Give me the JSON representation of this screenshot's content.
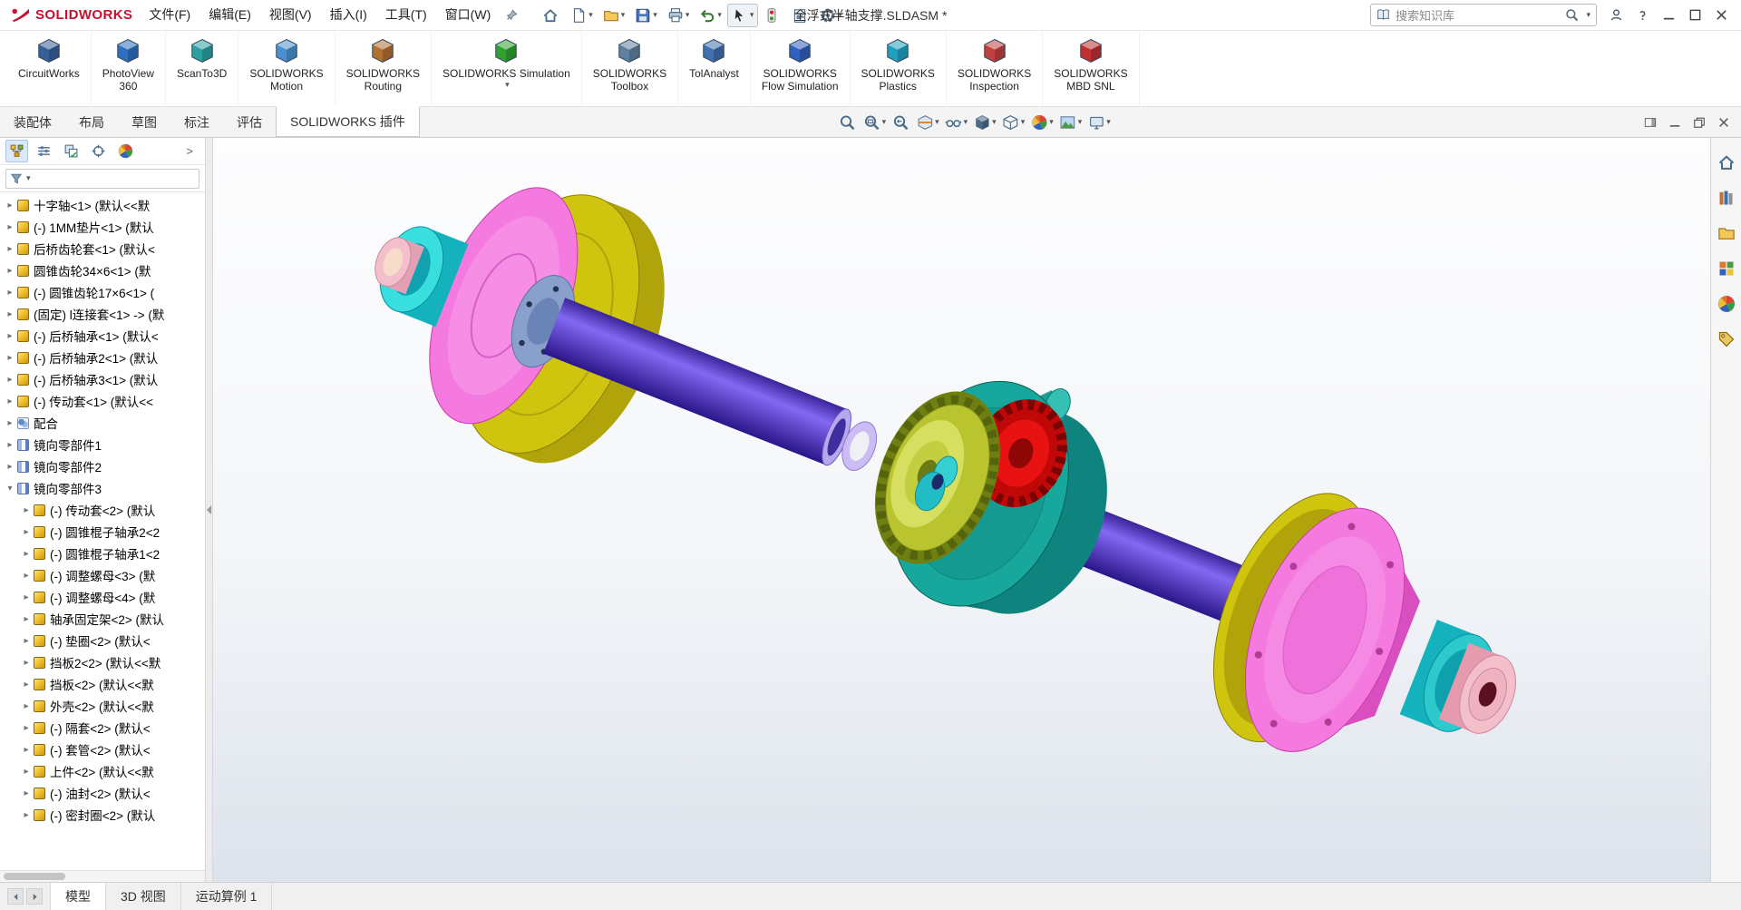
{
  "titlebar": {
    "brand": "SOLIDWORKS",
    "menus": [
      {
        "label": "文件(F)"
      },
      {
        "label": "编辑(E)"
      },
      {
        "label": "视图(V)"
      },
      {
        "label": "插入(I)"
      },
      {
        "label": "工具(T)"
      },
      {
        "label": "窗口(W)"
      }
    ],
    "document_title": "全浮式半轴支撑.SLDASM *",
    "quick_toolbar": [
      {
        "name": "home-button",
        "sym": "#i-home"
      },
      {
        "name": "new-document-button",
        "sym": "#i-newdoc",
        "caret": "▾"
      },
      {
        "name": "open-button",
        "sym": "#i-folder",
        "caret": "▾"
      },
      {
        "name": "save-button",
        "sym": "#i-floppy",
        "caret": "▾"
      },
      {
        "name": "print-button",
        "sym": "#i-printer",
        "caret": "▾"
      },
      {
        "name": "undo-button",
        "sym": "#i-undo",
        "caret": "▾"
      },
      {
        "name": "select-button",
        "sym": "#i-cursor",
        "caret": "▾",
        "boxed": "1"
      },
      {
        "name": "rebuild-button",
        "sym": "#i-rebuild"
      },
      {
        "name": "task-list-button",
        "sym": "#i-clipboard"
      },
      {
        "name": "options-button",
        "sym": "#i-gear",
        "caret": "▾"
      }
    ],
    "search": {
      "placeholder": "搜索知识库",
      "caret": "▾"
    },
    "right_icons": [
      {
        "name": "user-account-button",
        "sym": "#i-person"
      },
      {
        "name": "help-button",
        "sym": "#i-question"
      },
      {
        "name": "minimize-button",
        "sym": "#i-min"
      },
      {
        "name": "maximize-button",
        "sym": "#i-max"
      },
      {
        "name": "close-button",
        "sym": "#i-close"
      }
    ]
  },
  "ribbon": {
    "addins": [
      {
        "id": "circuitworks-button",
        "l1": "CircuitWorks",
        "l2": "",
        "style": "color:#35609a"
      },
      {
        "id": "photoview-360-button",
        "l1": "PhotoView",
        "l2": "360",
        "style": "color:#2e6fc0"
      },
      {
        "id": "scanto3d-button",
        "l1": "ScanTo3D",
        "l2": "",
        "style": "color:#2aa0a0"
      },
      {
        "id": "solidworks-motion-button",
        "l1": "SOLIDWORKS",
        "l2": "Motion",
        "style": "color:#4a90d0"
      },
      {
        "id": "solidworks-routing-button",
        "l1": "SOLIDWORKS",
        "l2": "Routing",
        "style": "color:#b07030"
      },
      {
        "id": "solidworks-simulation-button",
        "l1": "SOLIDWORKS Simulation",
        "l2": "",
        "style": "color:#30a030",
        "caret": "▾"
      },
      {
        "id": "solidworks-toolbox-button",
        "l1": "SOLIDWORKS",
        "l2": "Toolbox",
        "style": "color:#6080a0"
      },
      {
        "id": "tolanalyst-button",
        "l1": "TolAnalyst",
        "l2": "",
        "style": "color:#4070b0"
      },
      {
        "id": "solidworks-flow-simulation-button",
        "l1": "SOLIDWORKS",
        "l2": "Flow Simulation",
        "style": "color:#3060c0"
      },
      {
        "id": "solidworks-plastics-button",
        "l1": "SOLIDWORKS",
        "l2": "Plastics",
        "style": "color:#20a0c0"
      },
      {
        "id": "solidworks-inspection-button",
        "l1": "SOLIDWORKS",
        "l2": "Inspection",
        "style": "color:#c04040"
      },
      {
        "id": "solidworks-mbd-snl-button",
        "l1": "SOLIDWORKS",
        "l2": "MBD SNL",
        "style": "color:#c03030"
      }
    ]
  },
  "command_tabs": {
    "tabs": [
      {
        "label": "装配体"
      },
      {
        "label": "布局"
      },
      {
        "label": "草图"
      },
      {
        "label": "标注"
      },
      {
        "label": "评估"
      },
      {
        "label": "SOLIDWORKS 插件",
        "active": "1"
      }
    ]
  },
  "headsup": {
    "items": [
      {
        "name": "zoom-fit-icon",
        "sym": "#i-magnifier"
      },
      {
        "name": "zoom-area-icon",
        "sym": "#i-magnifier-rect",
        "caret": "▾"
      },
      {
        "name": "previous-view-icon",
        "sym": "#i-magnifier-prev"
      },
      {
        "name": "section-view-icon",
        "sym": "#i-section",
        "caret": "▾"
      },
      {
        "name": "hide-show-items-icon",
        "sym": "#i-glasses",
        "caret": "▾"
      },
      {
        "name": "view-orientation-icon",
        "sym": "#i-addin",
        "caret": "▾"
      },
      {
        "name": "display-style-icon",
        "sym": "#i-cube-wire",
        "caret": "▾"
      },
      {
        "name": "edit-appearance-icon",
        "sym": "#i-beachball",
        "caret": "▾"
      },
      {
        "name": "apply-scene-icon",
        "sym": "#i-scene",
        "caret": "▾"
      },
      {
        "name": "view-settings-icon",
        "sym": "#i-monitor",
        "caret": "▾"
      }
    ]
  },
  "doc_window_icons": [
    {
      "name": "pane-toggle-button",
      "sym": "#i-pane"
    },
    {
      "name": "doc-minimize-button",
      "sym": "#i-min"
    },
    {
      "name": "doc-restore-button",
      "sym": "#i-restore"
    },
    {
      "name": "doc-close-button",
      "sym": "#i-close"
    }
  ],
  "feature_panel": {
    "tabs": [
      {
        "name": "featuremanager-tab",
        "sym": "#i-tree",
        "active": "1"
      },
      {
        "name": "propertymanager-tab",
        "sym": "#i-sliders"
      },
      {
        "name": "configurationmanager-tab",
        "sym": "#i-config"
      },
      {
        "name": "dimxpertmanager-tab",
        "sym": "#i-target"
      },
      {
        "name": "displaymanager-tab",
        "sym": "#i-beachball"
      }
    ],
    "expand_glyph": ">",
    "filter": {
      "caret": "▾"
    },
    "items": [
      {
        "level": "1",
        "type": "part",
        "icon_name": "part-icon",
        "arrow": "▸",
        "label": "十字轴<1> (默认<<默"
      },
      {
        "level": "1",
        "type": "part",
        "icon_name": "part-icon",
        "arrow": "▸",
        "label": "(-) 1MM垫片<1> (默认"
      },
      {
        "level": "1",
        "type": "part",
        "icon_name": "part-icon",
        "arrow": "▸",
        "label": "后桥齿轮套<1> (默认<"
      },
      {
        "level": "1",
        "type": "part",
        "icon_name": "part-icon",
        "arrow": "▸",
        "label": "圆锥齿轮34×6<1> (默"
      },
      {
        "level": "1",
        "type": "part",
        "icon_name": "part-icon",
        "arrow": "▸",
        "label": "(-) 圆锥齿轮17×6<1> ("
      },
      {
        "level": "1",
        "type": "part",
        "icon_name": "part-icon",
        "arrow": "▸",
        "label": "(固定) l连接套<1> -> (默"
      },
      {
        "level": "1",
        "type": "part",
        "icon_name": "part-icon",
        "arrow": "▸",
        "label": "(-) 后桥轴承<1> (默认<"
      },
      {
        "level": "1",
        "type": "part",
        "icon_name": "part-icon",
        "arrow": "▸",
        "label": "(-) 后桥轴承2<1> (默认"
      },
      {
        "level": "1",
        "type": "part",
        "icon_name": "part-icon",
        "arrow": "▸",
        "label": "(-) 后桥轴承3<1> (默认"
      },
      {
        "level": "1",
        "type": "part",
        "icon_name": "part-icon",
        "arrow": "▸",
        "label": "(-) 传动套<1> (默认<<"
      },
      {
        "level": "1",
        "type": "mates",
        "icon_name": "mates-icon",
        "arrow": "▸",
        "label": "配合"
      },
      {
        "level": "1",
        "type": "mirror",
        "icon_name": "mirror-component-icon",
        "arrow": "▸",
        "label": "镜向零部件1"
      },
      {
        "level": "1",
        "type": "mirror",
        "icon_name": "mirror-component-icon",
        "arrow": "▸",
        "label": "镜向零部件2"
      },
      {
        "level": "1",
        "type": "mirror",
        "icon_name": "mirror-component-icon",
        "arrow": "▾",
        "label": "镜向零部件3"
      },
      {
        "level": "2",
        "type": "part",
        "icon_name": "part-icon",
        "arrow": "▸",
        "label": "(-) 传动套<2> (默认"
      },
      {
        "level": "2",
        "type": "part",
        "icon_name": "part-icon",
        "arrow": "▸",
        "label": "(-) 圆锥棍子轴承2<2"
      },
      {
        "level": "2",
        "type": "part",
        "icon_name": "part-icon",
        "arrow": "▸",
        "label": "(-) 圆锥棍子轴承1<2"
      },
      {
        "level": "2",
        "type": "part",
        "icon_name": "part-icon",
        "arrow": "▸",
        "label": "(-) 调整螺母<3> (默"
      },
      {
        "level": "2",
        "type": "part",
        "icon_name": "part-icon",
        "arrow": "▸",
        "label": "(-) 调整螺母<4> (默"
      },
      {
        "level": "2",
        "type": "part",
        "icon_name": "part-icon",
        "arrow": "▸",
        "label": "轴承固定架<2> (默认"
      },
      {
        "level": "2",
        "type": "part",
        "icon_name": "part-icon",
        "arrow": "▸",
        "label": "(-) 垫圈<2> (默认<"
      },
      {
        "level": "2",
        "type": "part",
        "icon_name": "part-icon",
        "arrow": "▸",
        "label": "挡板2<2> (默认<<默"
      },
      {
        "level": "2",
        "type": "part",
        "icon_name": "part-icon",
        "arrow": "▸",
        "label": "挡板<2> (默认<<默"
      },
      {
        "level": "2",
        "type": "part",
        "icon_name": "part-icon",
        "arrow": "▸",
        "label": "外壳<2> (默认<<默"
      },
      {
        "level": "2",
        "type": "part",
        "icon_name": "part-icon",
        "arrow": "▸",
        "label": "(-) 隔套<2> (默认<"
      },
      {
        "level": "2",
        "type": "part",
        "icon_name": "part-icon",
        "arrow": "▸",
        "label": "(-) 套管<2> (默认<"
      },
      {
        "level": "2",
        "type": "part",
        "icon_name": "part-icon",
        "arrow": "▸",
        "label": "上件<2> (默认<<默"
      },
      {
        "level": "2",
        "type": "part",
        "icon_name": "part-icon",
        "arrow": "▸",
        "label": "(-) 油封<2> (默认<"
      },
      {
        "level": "2",
        "type": "part",
        "icon_name": "part-icon",
        "arrow": "▸",
        "label": "(-) 密封圈<2> (默认"
      }
    ]
  },
  "taskpane": {
    "items": [
      {
        "name": "resources-tab",
        "sym": "#i-home",
        "style": "color:#4a6b8a"
      },
      {
        "name": "design-library-tab",
        "sym": "#i-books",
        "style": "color:#4a6b8a"
      },
      {
        "name": "file-explorer-tab",
        "sym": "#i-folder",
        "style": "color:#4a6b8a"
      },
      {
        "name": "view-palette-tab",
        "sym": "#i-palette",
        "style": "color:#4a6b8a"
      },
      {
        "name": "appearances-tab",
        "sym": "#i-beachball",
        "style": "color:#4a6b8a"
      },
      {
        "name": "custom-properties-tab",
        "sym": "#i-tag",
        "style": "color:#4a6b8a"
      }
    ]
  },
  "bottom_bar": {
    "nav": [
      {
        "name": "scroll-tabs-left-button",
        "sym": "#i-tri-left"
      },
      {
        "name": "scroll-tabs-right-button",
        "sym": "#i-tri-right"
      }
    ],
    "tabs": [
      {
        "label": "模型",
        "active": "1"
      },
      {
        "label": "3D 视图"
      },
      {
        "label": "运动算例 1"
      }
    ]
  },
  "viewport": {
    "part_colors": {
      "wheel_hub_pink": "#f47ae0",
      "wheel_disc_yellow": "#cfc40e",
      "axle_shaft_purple": "#5b3fd8",
      "hub_sleeve_cyan": "#39dede",
      "housing_teal": "#17a79c",
      "bevel_gear_red": "#e81212",
      "bevel_gear_green": "#b9c42f",
      "end_cap_pink": "#f2bfcb",
      "flange_blue": "#8aa0cc",
      "spacer_ring_lavender": "#cbbcf4"
    }
  }
}
